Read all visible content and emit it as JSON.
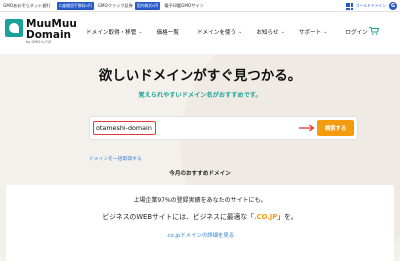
{
  "topbar": {
    "items": [
      "GMOあおぞらネット銀行",
      "GMOクリック証券",
      "電子印鑑GMOサイン"
    ],
    "badges": [
      "口座開設手数料0円",
      "国内株式0円"
    ],
    "right_link": "ゴールドドメイン",
    "right_icon": "grid-icon"
  },
  "header": {
    "logo_line1": "MuuMuu",
    "logo_line2": "Domain",
    "logo_by": "by GMOペパボ",
    "nav": [
      {
        "label": "ドメイン取得・移管",
        "dropdown": true
      },
      {
        "label": "価格一覧",
        "dropdown": false
      },
      {
        "label": "ドメインを使う",
        "dropdown": true
      },
      {
        "label": "お知らせ",
        "dropdown": true
      },
      {
        "label": "サポート",
        "dropdown": true
      }
    ],
    "login": "ログイン"
  },
  "hero": {
    "title": "欲しいドメインがすぐ見つかる。",
    "subtitle": "覚えられやすいドメイン名がおすすめです。",
    "search_value": "otameshi-domain",
    "search_button": "検索する",
    "bulk_link": "ドメインを一括取得する",
    "today_label": "今月のおすすめドメイン"
  },
  "promo": {
    "line1": "上場企業97%の登録実績をあなたのサイトにも。",
    "line2_before": "ビジネスのWEBサイトには、ビジネスに最適な「",
    "line2_highlight": ".CO.JP",
    "line2_after": "」を。",
    "link": ".co.jpドメインの詳細を見る"
  },
  "colors": {
    "accent_teal": "#1aa29a",
    "button_orange": "#f39c12",
    "link_blue": "#2d7fd3",
    "highlight_red": "#e53935"
  }
}
